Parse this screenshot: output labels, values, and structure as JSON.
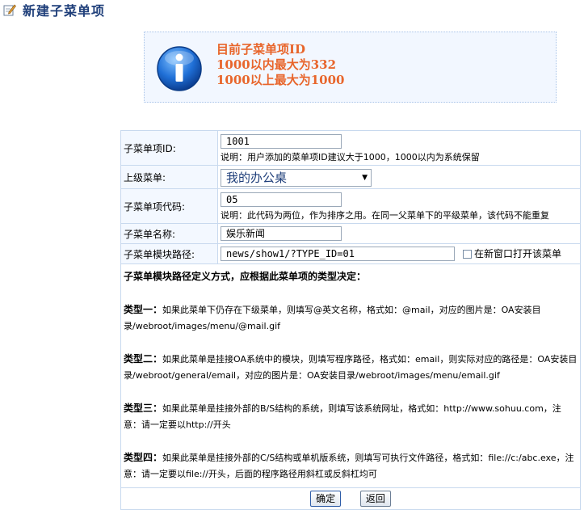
{
  "header": {
    "title": "新建子菜单项"
  },
  "notice": {
    "lines": [
      "目前子菜单项ID",
      "1000以内最大为332",
      "1000以上最大为1000"
    ]
  },
  "form": {
    "id": {
      "label": "子菜单项ID:",
      "value": "1001",
      "hint": "说明：用户添加的菜单项ID建议大于1000，1000以内为系统保留"
    },
    "parent": {
      "label": "上级菜单:",
      "value": "我的办公桌"
    },
    "code": {
      "label": "子菜单项代码:",
      "value": "05",
      "hint": "说明：此代码为两位，作为排序之用。在同一父菜单下的平级菜单，该代码不能重复"
    },
    "name": {
      "label": "子菜单名称:",
      "value": "娱乐新闻"
    },
    "path": {
      "label": "子菜单模块路径:",
      "value": "news/show1/?TYPE_ID=01",
      "checkbox_label": "在新窗口打开该菜单",
      "checked": false
    }
  },
  "description": {
    "heading": "子菜单模块路径定义方式，应根据此菜单项的类型决定：",
    "types": [
      {
        "title": "类型一：",
        "text": "如果此菜单下仍存在下级菜单，则填写@英文名称，格式如：@mail，对应的图片是：OA安装目录/webroot/images/menu/@mail.gif"
      },
      {
        "title": "类型二：",
        "text": "如果此菜单是挂接OA系统中的模块，则填写程序路径，格式如：email，则实际对应的路径是：OA安装目录/webroot/general/email，对应的图片是：OA安装目录/webroot/images/menu/email.gif"
      },
      {
        "title": "类型三：",
        "text": "如果此菜单是挂接外部的B/S结构的系统，则填写该系统网址，格式如：http://www.sohuu.com，注意：请一定要以http://开头"
      },
      {
        "title": "类型四：",
        "text": "如果此菜单是挂接外部的C/S结构或单机版系统，则填写可执行文件路径，格式如：file://c:/abc.exe，注意：请一定要以file://开头，后面的程序路径用斜杠或反斜杠均可"
      }
    ]
  },
  "buttons": {
    "ok": "确定",
    "back": "返回"
  }
}
